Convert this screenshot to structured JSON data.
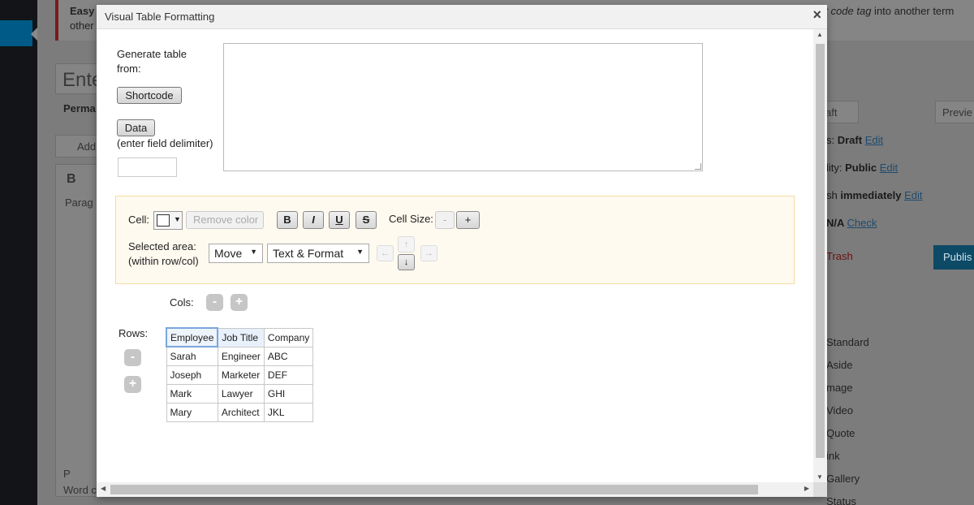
{
  "background_page": {
    "notice": {
      "line1": "Easy",
      "line2": "other",
      "line3_italic": "rt code tag",
      "line3_rest": " into another term"
    },
    "title_placeholder": "Ente",
    "permalink_label": "Perma",
    "add_media_label": "Add",
    "editor": {
      "bold_label": "B",
      "format_label": "Parag",
      "path_label": "P",
      "word_count_label": "Word c"
    },
    "publish_box": {
      "save_draft": "aft",
      "preview": "Previe",
      "status_label": "s: ",
      "status_value": "Draft",
      "status_edit": "Edit",
      "visibility_label": "lity: ",
      "visibility_value": "Public",
      "visibility_edit": "Edit",
      "publish_label": "sh ",
      "publish_value": "immediately",
      "publish_edit": "Edit",
      "seo_label": "N/A ",
      "seo_check": "Check",
      "trash": "Trash",
      "publish_button": "Publis"
    },
    "formats": [
      "Standard",
      "Aside",
      "mage",
      "Video",
      "Quote",
      "ink",
      "Gallery",
      "Status"
    ]
  },
  "modal": {
    "title": "Visual Table Formatting",
    "close_label": "×",
    "generate_label_line1": "Generate table",
    "generate_label_line2": "from:",
    "shortcode_button": "Shortcode",
    "data_button": "Data",
    "delimiter_hint": "(enter field delimiter)",
    "delimiter_value": "",
    "source_text": "",
    "format_panel": {
      "cell_label": "Cell:",
      "cell_color": "#ffffff",
      "remove_color": "Remove color",
      "bold": "B",
      "italic": "I",
      "underline": "U",
      "strike": "S",
      "cell_size_label": "Cell Size:",
      "size_minus": "-",
      "size_plus": "+",
      "selected_area_line1": "Selected area:",
      "selected_area_line2": "(within row/col)",
      "action_select": "Move",
      "scope_select": "Text & Format",
      "arrow_left": "←",
      "arrow_up": "↑",
      "arrow_down": "↓",
      "arrow_right": "→"
    },
    "cols_label": "Cols:",
    "cols_minus": "-",
    "cols_plus": "+",
    "rows_label": "Rows:",
    "rows_minus": "-",
    "rows_plus": "+",
    "table": [
      [
        "Employee",
        "Job Title",
        "Company"
      ],
      [
        "Sarah",
        "Engineer",
        "ABC"
      ],
      [
        "Joseph",
        "Marketer",
        "DEF"
      ],
      [
        "Mark",
        "Lawyer",
        "GHI"
      ],
      [
        "Mary",
        "Architect",
        "JKL"
      ]
    ]
  }
}
